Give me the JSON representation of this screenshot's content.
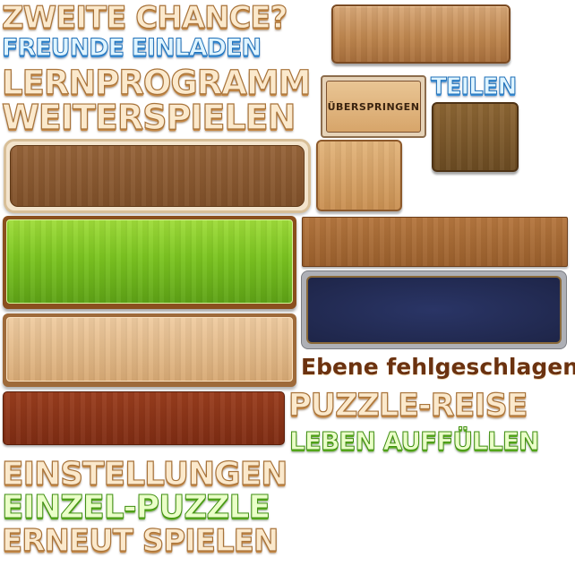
{
  "labels": {
    "second_chance": "ZWEITE CHANCE?",
    "invite_friends": "FREUNDE EINLADEN",
    "tutorial": "LERNPROGRAMM",
    "share": "TEILEN",
    "continue_playing": "WEITERSPIELEN",
    "level_failed": "Ebene fehlgeschlagen",
    "puzzle_journey": "PUZZLE-REISE",
    "refill_lives": "LEBEN AUFFÜLLEN",
    "settings": "EINSTELLUNGEN",
    "single_puzzle": "EINZEL-PUZZLE",
    "play_again": "ERNEUT SPIELEN"
  },
  "buttons": {
    "skip_label": "ÜBERSPRINGEN"
  },
  "colors": {
    "wood_light": "#d8a878",
    "wood_mid": "#96643a",
    "wood_dark": "#6b4b22",
    "green": "#7cc521",
    "navy": "#1e2548",
    "cherry": "#8a3417",
    "label_tan": "#fbe9cc",
    "label_blue": "#dff4ff",
    "label_green": "#eaffc8",
    "label_brown": "#6b3210"
  }
}
